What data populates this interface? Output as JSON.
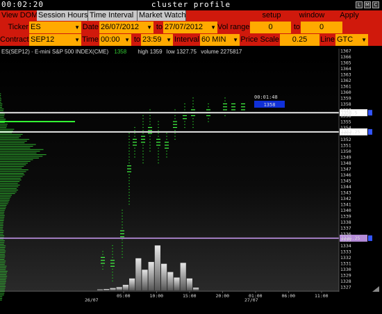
{
  "window": {
    "clock": "00:02:20",
    "title": "cluster profile",
    "buttons": [
      "L",
      "M",
      "C"
    ]
  },
  "tabs": [
    {
      "label": "View DOM",
      "active": true
    },
    {
      "label": "Session Hours",
      "active": false
    },
    {
      "label": "Time Interval",
      "active": false
    },
    {
      "label": "Market Watch",
      "active": false
    }
  ],
  "toolbar": {
    "setup_label": "setup",
    "window_label": "window",
    "apply_label": "Apply"
  },
  "controls": {
    "ticker_label": "Ticker",
    "ticker_value": "ES",
    "date_label": "Date",
    "date_from": "26/07/2012",
    "to_label": "to",
    "date_to": "27/07/2012",
    "vol_range_label": "Vol range",
    "vol_from": "0",
    "vol_to_label": "to",
    "vol_to": "0",
    "contract_label": "Contract",
    "contract_value": "SEP12",
    "time_label": "Time",
    "time_from": "00:00",
    "time_to_label": "to",
    "time_to": "23:59",
    "interval_label": "Interval",
    "interval_value": "60 MIN",
    "price_scale_label": "Price Scale",
    "price_scale_value": "0.25",
    "line_label": "Line",
    "line_value": "GTC"
  },
  "instrument": {
    "symbol": "ES(SEP12)",
    "description": "E-mini S&P 500 INDEX(CME)",
    "last": "1358",
    "high": "high 1359",
    "low": "low 1327.75",
    "volume": "volume 2275817"
  },
  "chart_data": {
    "type": "other",
    "countdown": "00:01:48",
    "current_price_label": "1358",
    "y_ticks": [
      "1367",
      "1366",
      "1365",
      "1364",
      "1363",
      "1362",
      "1361",
      "1360",
      "1359",
      "1358",
      "1357",
      "1356",
      "1355",
      "1354",
      "1353",
      "1352",
      "1351",
      "1350",
      "1349",
      "1348",
      "1347",
      "1346",
      "1345",
      "1344",
      "1343",
      "1342",
      "1341",
      "1340",
      "1339",
      "1338",
      "1337",
      "1336",
      "1335",
      "1334",
      "1333",
      "1332",
      "1331",
      "1330",
      "1329",
      "1328",
      "1327"
    ],
    "ylim": [
      1327,
      1367
    ],
    "x_ticks": [
      {
        "time": "05:00",
        "date": ""
      },
      {
        "time": "10:00",
        "date": ""
      },
      {
        "time": "15:00",
        "date": ""
      },
      {
        "time": "20:00",
        "date": ""
      },
      {
        "time": "01:00",
        "date": "27/07"
      },
      {
        "time": "06:00",
        "date": ""
      },
      {
        "time": "11:00",
        "date": ""
      }
    ],
    "x_start_date": "26/07",
    "lines": [
      {
        "price": 1356.5,
        "label": "1356.5",
        "color": "#ffffff"
      },
      {
        "price": 1353.25,
        "label": "1353.25",
        "color": "#ffffff"
      },
      {
        "price": 1335.25,
        "label": "1335.25",
        "color": "#b58bd8"
      }
    ],
    "volume_bars": [
      0.02,
      0.03,
      0.05,
      0.07,
      0.12,
      0.26,
      0.7,
      0.45,
      0.62,
      0.98,
      0.58,
      0.4,
      0.28,
      0.6,
      0.26,
      0.06
    ],
    "profile": [
      0.02,
      0.03,
      0.05,
      0.08,
      0.1,
      0.12,
      0.16,
      0.3,
      0.48,
      0.62,
      0.76,
      0.92,
      0.98,
      0.7,
      0.55,
      0.6,
      0.52,
      0.45,
      0.42,
      0.38,
      0.25,
      0.2,
      0.14,
      0.1,
      0.1,
      0.08,
      0.07,
      0.08,
      0.09,
      0.1,
      0.12,
      0.12,
      0.11,
      0.12,
      0.14,
      0.16,
      0.15,
      0.13,
      0.12,
      0.1,
      0.05
    ]
  }
}
